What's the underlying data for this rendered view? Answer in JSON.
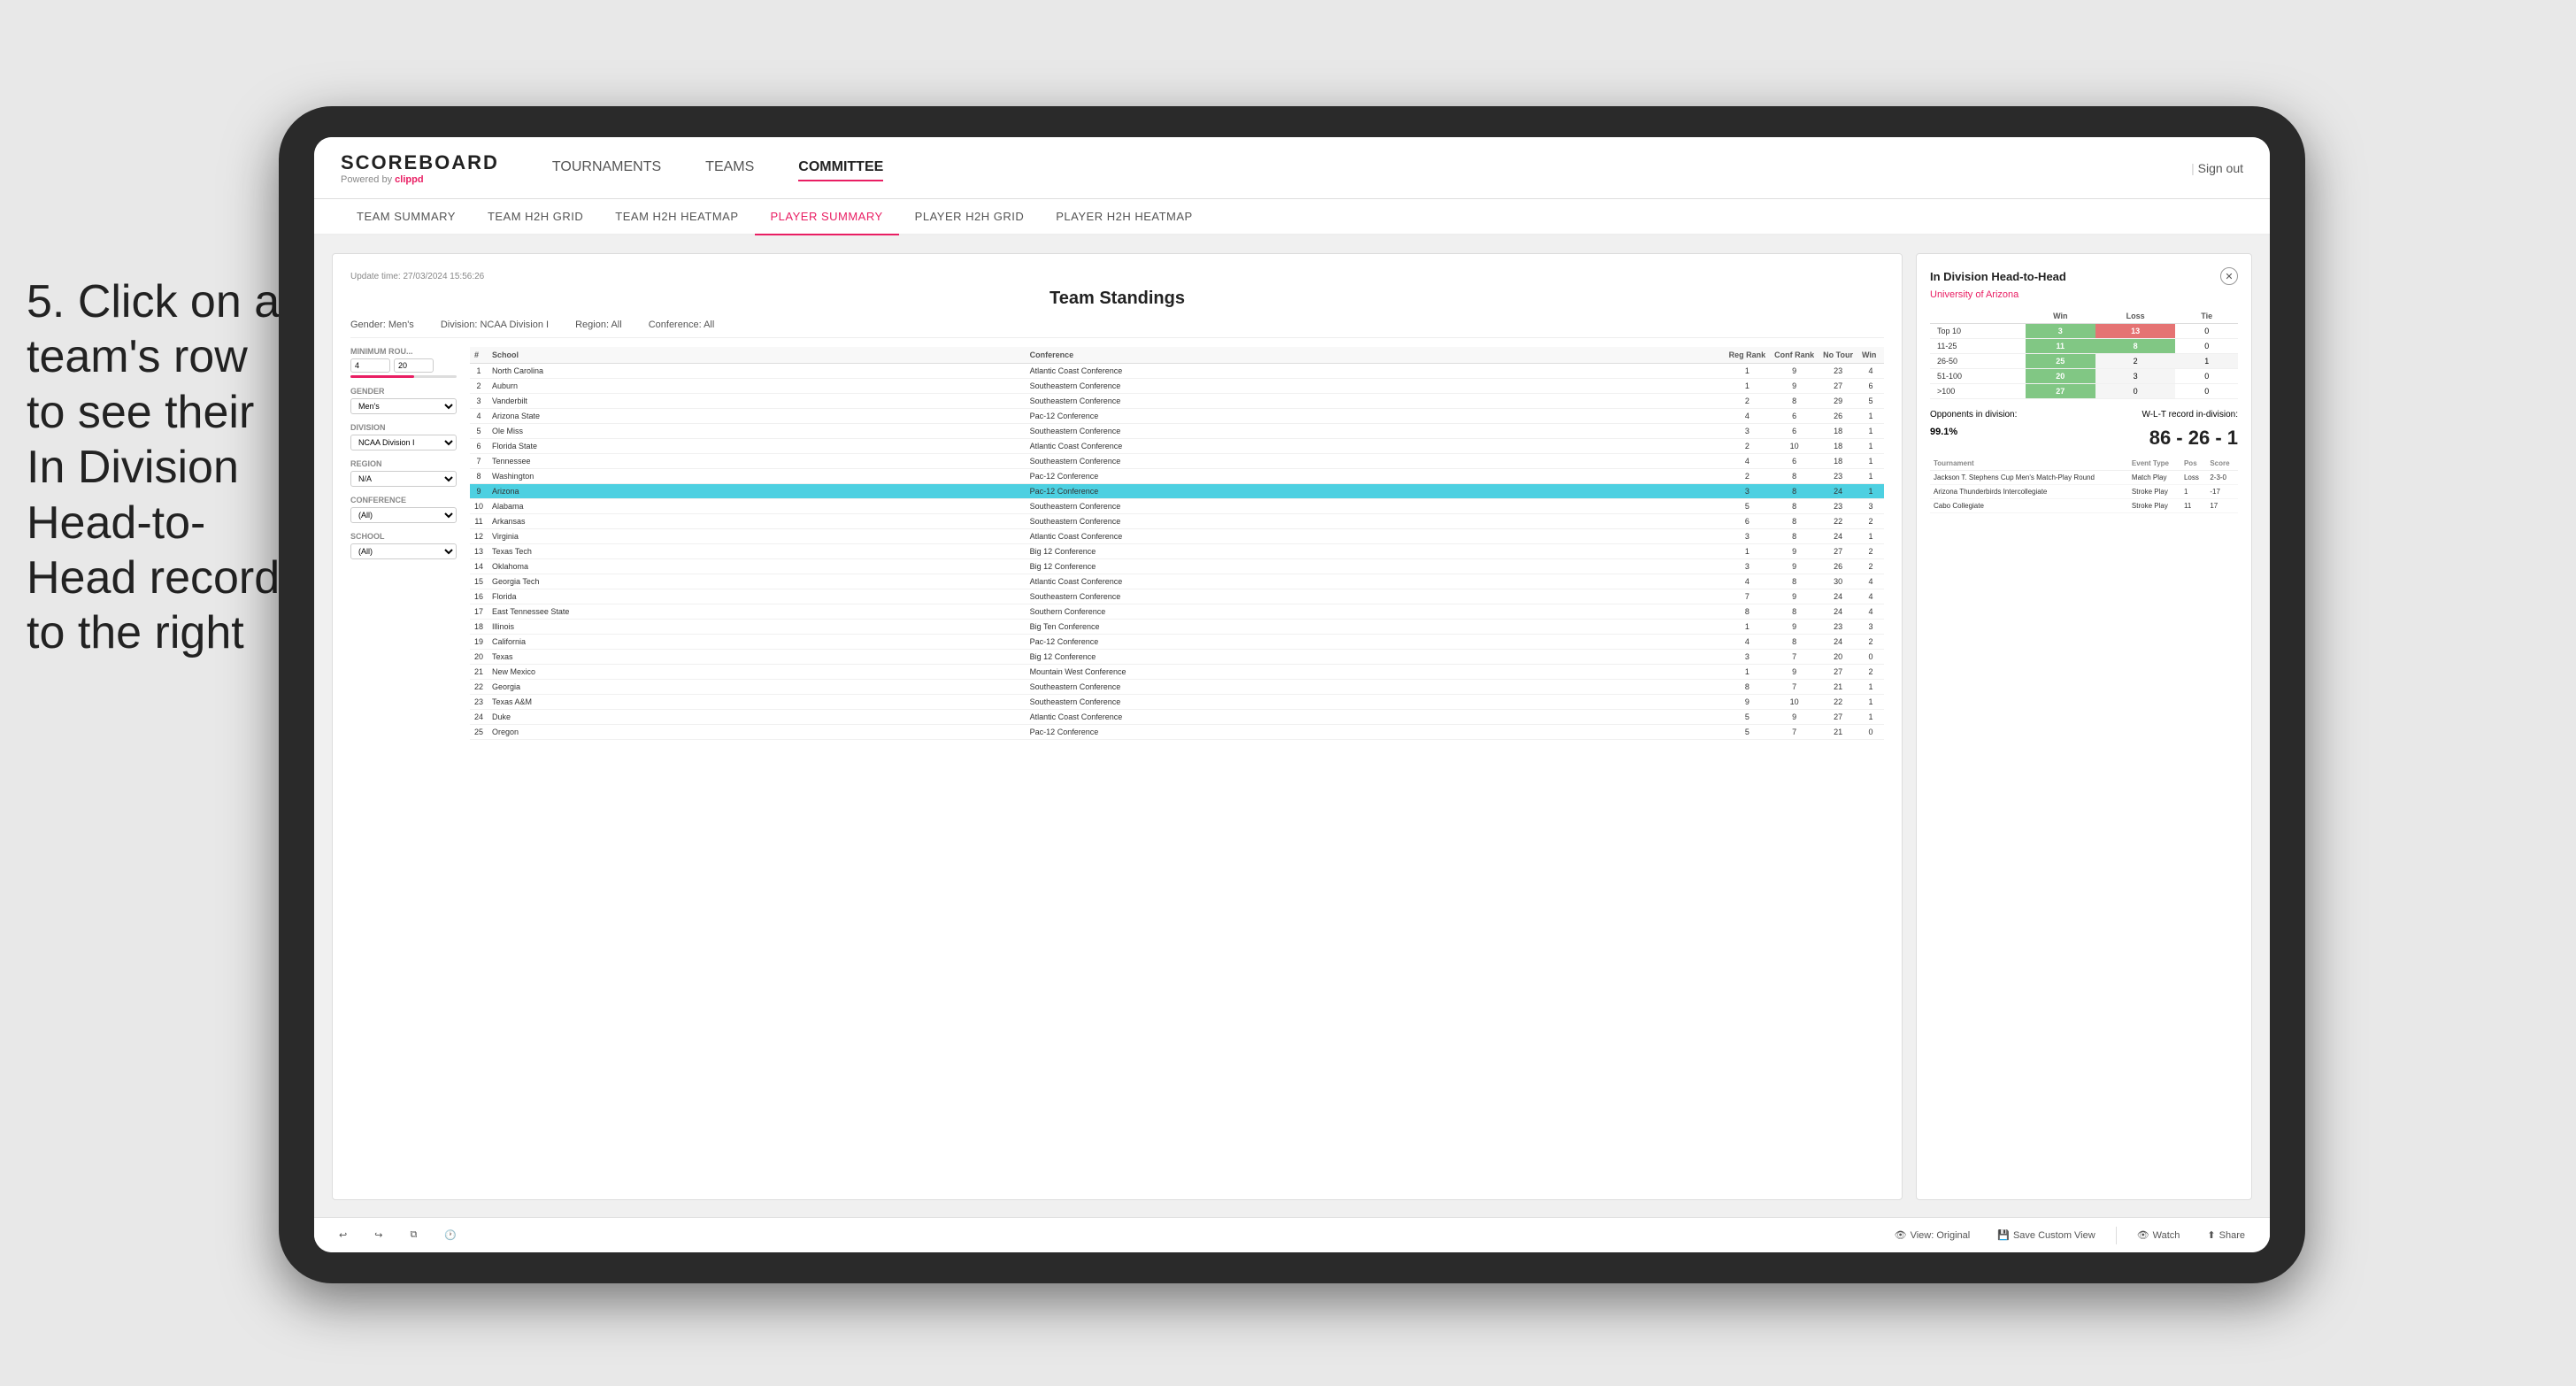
{
  "annotation": {
    "text": "5. Click on a team's row to see their In Division Head-to-Head record to the right"
  },
  "nav": {
    "logo": "SCOREBOARD",
    "powered_by": "Powered by clippd",
    "items": [
      "TOURNAMENTS",
      "TEAMS",
      "COMMITTEE"
    ],
    "active_item": "COMMITTEE",
    "sign_out": "Sign out"
  },
  "sub_nav": {
    "items": [
      "TEAM SUMMARY",
      "TEAM H2H GRID",
      "TEAM H2H HEATMAP",
      "PLAYER SUMMARY",
      "PLAYER H2H GRID",
      "PLAYER H2H HEATMAP"
    ],
    "active_item": "PLAYER SUMMARY"
  },
  "panel": {
    "update_time_label": "Update time:",
    "update_time": "27/03/2024 15:56:26",
    "title": "Team Standings",
    "gender_label": "Gender:",
    "gender_val": "Men's",
    "division_label": "Division:",
    "division_val": "NCAA Division I",
    "region_label": "Region:",
    "region_val": "All",
    "conference_label": "Conference:",
    "conference_val": "All"
  },
  "filters": {
    "min_rounds_label": "Minimum Rou...",
    "min_rounds_val": "4",
    "min_rounds_max": "20",
    "gender_label": "Gender",
    "gender_val": "Men's",
    "division_label": "Division",
    "division_val": "NCAA Division I",
    "region_label": "Region",
    "region_val": "N/A",
    "conference_label": "Conference",
    "conference_val": "(All)",
    "school_label": "School",
    "school_val": "(All)"
  },
  "table": {
    "headers": [
      "#",
      "School",
      "Conference",
      "Reg Rank",
      "Conf Rank",
      "No Tour",
      "Win"
    ],
    "rows": [
      {
        "rank": 1,
        "school": "North Carolina",
        "conference": "Atlantic Coast Conference",
        "reg_rank": 1,
        "conf_rank": 9,
        "no_tour": 23,
        "win": 4,
        "selected": false
      },
      {
        "rank": 2,
        "school": "Auburn",
        "conference": "Southeastern Conference",
        "reg_rank": 1,
        "conf_rank": 9,
        "no_tour": 27,
        "win": 6,
        "selected": false
      },
      {
        "rank": 3,
        "school": "Vanderbilt",
        "conference": "Southeastern Conference",
        "reg_rank": 2,
        "conf_rank": 8,
        "no_tour": 29,
        "win": 5,
        "selected": false
      },
      {
        "rank": 4,
        "school": "Arizona State",
        "conference": "Pac-12 Conference",
        "reg_rank": 4,
        "conf_rank": 6,
        "no_tour": 26,
        "win": 1,
        "selected": false
      },
      {
        "rank": 5,
        "school": "Ole Miss",
        "conference": "Southeastern Conference",
        "reg_rank": 3,
        "conf_rank": 6,
        "no_tour": 18,
        "win": 1,
        "selected": false
      },
      {
        "rank": 6,
        "school": "Florida State",
        "conference": "Atlantic Coast Conference",
        "reg_rank": 2,
        "conf_rank": 10,
        "no_tour": 18,
        "win": 1,
        "selected": false
      },
      {
        "rank": 7,
        "school": "Tennessee",
        "conference": "Southeastern Conference",
        "reg_rank": 4,
        "conf_rank": 6,
        "no_tour": 18,
        "win": 1,
        "selected": false
      },
      {
        "rank": 8,
        "school": "Washington",
        "conference": "Pac-12 Conference",
        "reg_rank": 2,
        "conf_rank": 8,
        "no_tour": 23,
        "win": 1,
        "selected": false
      },
      {
        "rank": 9,
        "school": "Arizona",
        "conference": "Pac-12 Conference",
        "reg_rank": 3,
        "conf_rank": 8,
        "no_tour": 24,
        "win": 1,
        "selected": true
      },
      {
        "rank": 10,
        "school": "Alabama",
        "conference": "Southeastern Conference",
        "reg_rank": 5,
        "conf_rank": 8,
        "no_tour": 23,
        "win": 3,
        "selected": false
      },
      {
        "rank": 11,
        "school": "Arkansas",
        "conference": "Southeastern Conference",
        "reg_rank": 6,
        "conf_rank": 8,
        "no_tour": 22,
        "win": 2,
        "selected": false
      },
      {
        "rank": 12,
        "school": "Virginia",
        "conference": "Atlantic Coast Conference",
        "reg_rank": 3,
        "conf_rank": 8,
        "no_tour": 24,
        "win": 1,
        "selected": false
      },
      {
        "rank": 13,
        "school": "Texas Tech",
        "conference": "Big 12 Conference",
        "reg_rank": 1,
        "conf_rank": 9,
        "no_tour": 27,
        "win": 2,
        "selected": false
      },
      {
        "rank": 14,
        "school": "Oklahoma",
        "conference": "Big 12 Conference",
        "reg_rank": 3,
        "conf_rank": 9,
        "no_tour": 26,
        "win": 2,
        "selected": false
      },
      {
        "rank": 15,
        "school": "Georgia Tech",
        "conference": "Atlantic Coast Conference",
        "reg_rank": 4,
        "conf_rank": 8,
        "no_tour": 30,
        "win": 4,
        "selected": false
      },
      {
        "rank": 16,
        "school": "Florida",
        "conference": "Southeastern Conference",
        "reg_rank": 7,
        "conf_rank": 9,
        "no_tour": 24,
        "win": 4,
        "selected": false
      },
      {
        "rank": 17,
        "school": "East Tennessee State",
        "conference": "Southern Conference",
        "reg_rank": 8,
        "conf_rank": 8,
        "no_tour": 24,
        "win": 4,
        "selected": false
      },
      {
        "rank": 18,
        "school": "Illinois",
        "conference": "Big Ten Conference",
        "reg_rank": 1,
        "conf_rank": 9,
        "no_tour": 23,
        "win": 3,
        "selected": false
      },
      {
        "rank": 19,
        "school": "California",
        "conference": "Pac-12 Conference",
        "reg_rank": 4,
        "conf_rank": 8,
        "no_tour": 24,
        "win": 2,
        "selected": false
      },
      {
        "rank": 20,
        "school": "Texas",
        "conference": "Big 12 Conference",
        "reg_rank": 3,
        "conf_rank": 7,
        "no_tour": 20,
        "win": 0,
        "selected": false
      },
      {
        "rank": 21,
        "school": "New Mexico",
        "conference": "Mountain West Conference",
        "reg_rank": 1,
        "conf_rank": 9,
        "no_tour": 27,
        "win": 2,
        "selected": false
      },
      {
        "rank": 22,
        "school": "Georgia",
        "conference": "Southeastern Conference",
        "reg_rank": 8,
        "conf_rank": 7,
        "no_tour": 21,
        "win": 1,
        "selected": false
      },
      {
        "rank": 23,
        "school": "Texas A&M",
        "conference": "Southeastern Conference",
        "reg_rank": 9,
        "conf_rank": 10,
        "no_tour": 22,
        "win": 1,
        "selected": false
      },
      {
        "rank": 24,
        "school": "Duke",
        "conference": "Atlantic Coast Conference",
        "reg_rank": 5,
        "conf_rank": 9,
        "no_tour": 27,
        "win": 1,
        "selected": false
      },
      {
        "rank": 25,
        "school": "Oregon",
        "conference": "Pac-12 Conference",
        "reg_rank": 5,
        "conf_rank": 7,
        "no_tour": 21,
        "win": 0,
        "selected": false
      }
    ]
  },
  "h2h": {
    "title": "In Division Head-to-Head",
    "team": "University of Arizona",
    "win_label": "Win",
    "loss_label": "Loss",
    "tie_label": "Tie",
    "rows": [
      {
        "range": "Top 10",
        "win": 3,
        "loss": 13,
        "tie": 0,
        "win_color": "green",
        "loss_color": "red"
      },
      {
        "range": "11-25",
        "win": 11,
        "loss": 8,
        "tie": 0,
        "win_color": "green",
        "loss_color": "green"
      },
      {
        "range": "26-50",
        "win": 25,
        "loss": 2,
        "tie": 1,
        "win_color": "green",
        "loss_color": "gray"
      },
      {
        "range": "51-100",
        "win": 20,
        "loss": 3,
        "tie": 0,
        "win_color": "green",
        "loss_color": "gray"
      },
      {
        "range": ">100",
        "win": 27,
        "loss": 0,
        "tie": 0,
        "win_color": "green",
        "loss_color": "gray"
      }
    ],
    "opponents_label": "Opponents in division:",
    "opponents_val": "99.1%",
    "wlt_label": "W-L-T record in-division:",
    "wlt_val": "86 - 26 - 1",
    "tournaments": [
      {
        "name": "Jackson T. Stephens Cup Men's Match-Play Round",
        "event_type": "Match Play",
        "pos": "Loss",
        "score": "2-3-0"
      },
      {
        "name": "Arizona Thunderbirds Intercollegiate",
        "event_type": "Stroke Play",
        "pos": "1",
        "score": "-17"
      },
      {
        "name": "Cabo Collegiate",
        "event_type": "Stroke Play",
        "pos": "11",
        "score": "17"
      }
    ],
    "tournament_headers": [
      "Tournament",
      "Event Type",
      "Pos",
      "Score"
    ]
  },
  "toolbar": {
    "undo": "↩",
    "redo": "↪",
    "view_original": "View: Original",
    "save_custom": "Save Custom View",
    "watch": "Watch",
    "share": "Share"
  },
  "colors": {
    "accent": "#e91e63",
    "selected_row": "#4dd0e1",
    "green_cell": "#81c784",
    "red_cell": "#e57373"
  }
}
